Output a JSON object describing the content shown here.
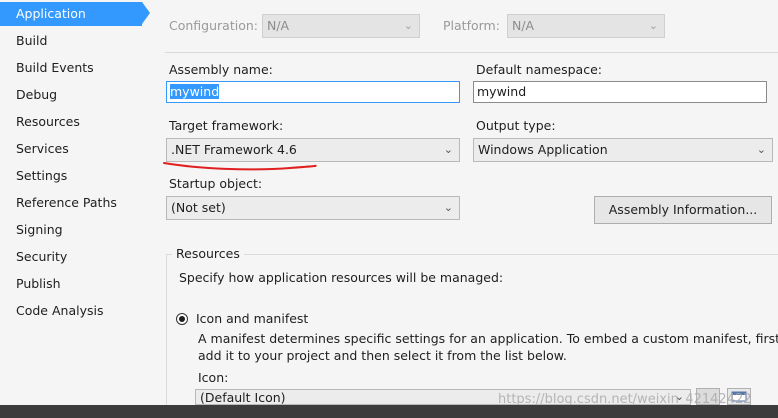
{
  "sidebar": {
    "items": [
      {
        "label": "Application",
        "active": true
      },
      {
        "label": "Build"
      },
      {
        "label": "Build Events"
      },
      {
        "label": "Debug"
      },
      {
        "label": "Resources"
      },
      {
        "label": "Services"
      },
      {
        "label": "Settings"
      },
      {
        "label": "Reference Paths"
      },
      {
        "label": "Signing"
      },
      {
        "label": "Security"
      },
      {
        "label": "Publish"
      },
      {
        "label": "Code Analysis"
      }
    ]
  },
  "top_bar": {
    "configuration_label": "Configuration:",
    "configuration_value": "N/A",
    "platform_label": "Platform:",
    "platform_value": "N/A"
  },
  "form": {
    "assembly_name_label": "Assembly name:",
    "assembly_name_value": "mywind",
    "default_namespace_label": "Default namespace:",
    "default_namespace_value": "mywind",
    "target_framework_label": "Target framework:",
    "target_framework_value": ".NET Framework 4.6",
    "output_type_label": "Output type:",
    "output_type_value": "Windows Application",
    "startup_object_label": "Startup object:",
    "startup_object_value": "(Not set)",
    "assembly_info_button": "Assembly Information..."
  },
  "resources": {
    "title": "Resources",
    "description": "Specify how application resources will be managed:",
    "option_icon_manifest": "Icon and manifest",
    "option_icon_manifest_selected": true,
    "manifest_help_line1": "A manifest determines specific settings for an application. To embed a custom manifest, first",
    "manifest_help_line2": "add it to your project and then select it from the list below.",
    "icon_label": "Icon:",
    "icon_value": "(Default Icon)"
  },
  "watermark": "https://blog.csdn.net/weixin_42142422",
  "colors": {
    "accent": "#3399ff",
    "annotation_red": "#e02020"
  }
}
